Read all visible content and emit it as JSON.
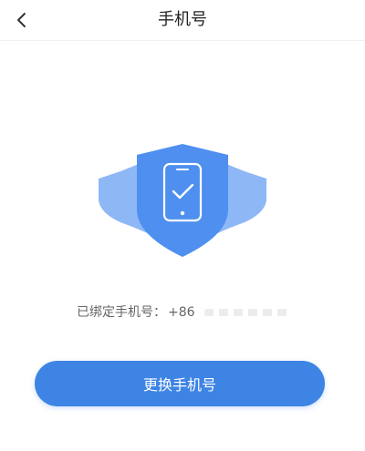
{
  "header": {
    "title": "手机号",
    "back_icon": "chevron-left-icon"
  },
  "illustration": {
    "icons": [
      "shield-icon",
      "phone-icon",
      "check-icon"
    ],
    "colors": {
      "shield_front": "#4f8ff0",
      "shield_side": "#8eb8f5",
      "phone_outline": "#ffffff"
    }
  },
  "binding": {
    "label": "已绑定手机号：",
    "phone_prefix": "+86"
  },
  "actions": {
    "change_label": "更换手机号"
  },
  "theme": {
    "accent": "#3d84e5",
    "text_primary": "#222222",
    "text_secondary": "#666666"
  }
}
